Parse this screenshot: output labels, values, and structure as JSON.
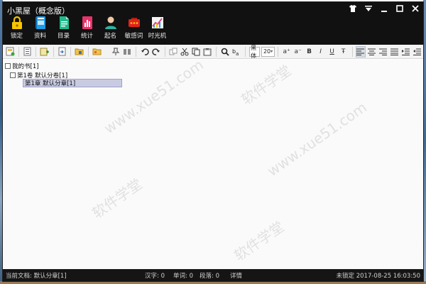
{
  "window": {
    "title": "小黑屋（概念版）",
    "controls": [
      "shirt-icon",
      "dropdown-icon",
      "minimize-icon",
      "maximize-icon",
      "close-icon"
    ]
  },
  "ribbon": [
    {
      "label": "锁定",
      "icon": "lock-icon"
    },
    {
      "label": "资料",
      "icon": "book-icon"
    },
    {
      "label": "目录",
      "icon": "document-icon"
    },
    {
      "label": "统计",
      "icon": "stats-icon"
    },
    {
      "label": "起名",
      "icon": "person-icon"
    },
    {
      "label": "敏感词",
      "icon": "alert-icon"
    },
    {
      "label": "时光机",
      "icon": "chart-icon"
    }
  ],
  "toolbar": {
    "font_name": "黑体",
    "font_size": "20",
    "font_size_arrow": "▾",
    "grow_font": "a⁺",
    "shrink_font": "a⁻",
    "bold": "B",
    "italic": "I",
    "underline": "U",
    "strike": "Ŧ"
  },
  "tree": {
    "book": "我的书[1]",
    "volume": "第1卷 默认分卷[1]",
    "chapter": "第1章 默认分章[1]"
  },
  "watermark": {
    "text1": "www.xue51.com",
    "text2": "软件学堂"
  },
  "status": {
    "current_doc": "当前文档: 默认分章[1]",
    "chars": "汉字: 0",
    "words": "单词: 0",
    "paragraphs": "段落: 0",
    "details": "详情",
    "lock_state": "未锁定 2017-08-25 16:03:50"
  },
  "colors": {
    "titlebar": "#111111",
    "selection": "#c9cbe3",
    "statusbar": "#151515"
  }
}
